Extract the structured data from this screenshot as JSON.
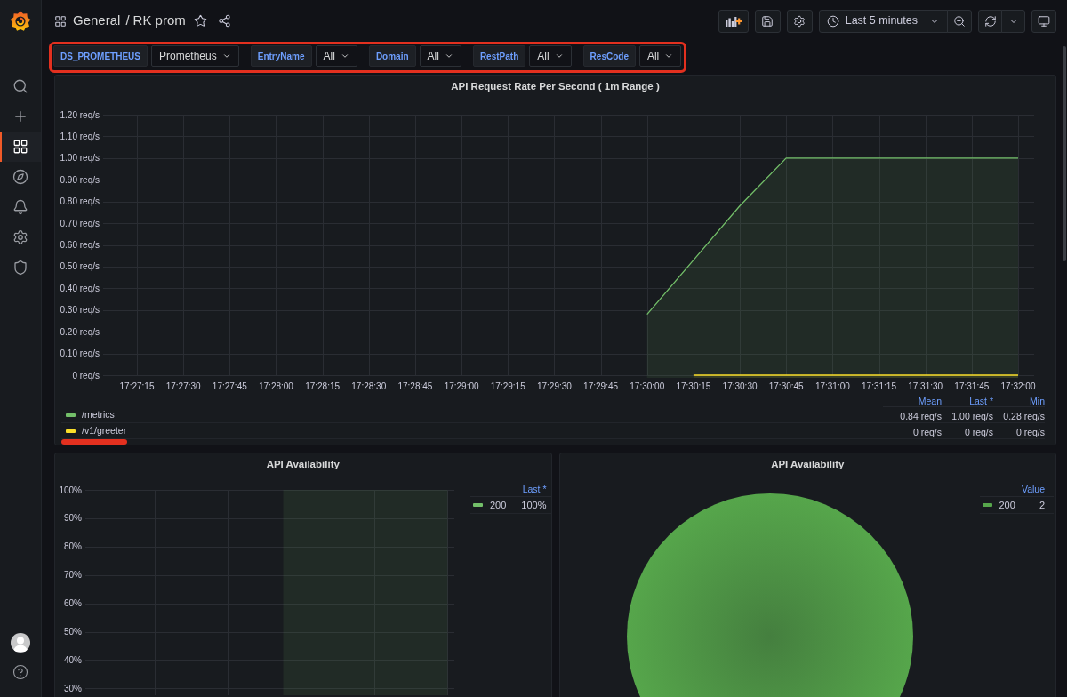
{
  "sidebar": {
    "items": [
      {
        "kind": "search",
        "selected": false
      },
      {
        "kind": "create",
        "selected": false
      },
      {
        "kind": "dashboards",
        "selected": true
      },
      {
        "kind": "explore",
        "selected": false
      },
      {
        "kind": "alerting",
        "selected": false
      },
      {
        "kind": "configuration",
        "selected": false
      },
      {
        "kind": "server_admin",
        "selected": false
      }
    ],
    "bottom": [
      {
        "kind": "profile"
      },
      {
        "kind": "help"
      }
    ]
  },
  "header": {
    "folder": "General",
    "separator": "/",
    "title": "RK prom",
    "starred": false
  },
  "toolbar": [
    {
      "kind": "add_panel"
    },
    {
      "kind": "save"
    },
    {
      "kind": "settings"
    },
    {
      "kind": "time_range",
      "label": "Last 5 minutes"
    },
    {
      "kind": "zoom_out"
    },
    {
      "kind": "refresh"
    },
    {
      "kind": "refresh_interval"
    },
    {
      "kind": "tv_mode"
    }
  ],
  "variables": {
    "highlighted": true,
    "items": [
      {
        "label": "DS_PROMETHEUS",
        "value": "Prometheus"
      },
      {
        "label": "EntryName",
        "value": "All"
      },
      {
        "label": "Domain",
        "value": "All"
      },
      {
        "label": "RestPath",
        "value": "All"
      },
      {
        "label": "ResCode",
        "value": "All"
      }
    ]
  },
  "panels": [
    {
      "kind": "timeseries",
      "title": "API Request Rate Per Second ( 1m Range )",
      "chart_data": {
        "type": "area",
        "grid": true,
        "categories": [
          "17:27:15",
          "17:27:30",
          "17:27:45",
          "17:28:00",
          "17:28:15",
          "17:28:30",
          "17:28:45",
          "17:29:00",
          "17:29:15",
          "17:29:30",
          "17:29:45",
          "17:30:00",
          "17:30:15",
          "17:30:30",
          "17:30:45",
          "17:31:00",
          "17:31:15",
          "17:31:30",
          "17:31:45",
          "17:32:00"
        ],
        "ylim": [
          0,
          1.2
        ],
        "yticks": [
          {
            "value": 1.2,
            "label": "1.20 req/s"
          },
          {
            "value": 1.1,
            "label": "1.10 req/s"
          },
          {
            "value": 1,
            "label": "1.00 req/s"
          },
          {
            "value": 0.9,
            "label": "0.90 req/s"
          },
          {
            "value": 0.8,
            "label": "0.80 req/s"
          },
          {
            "value": 0.7,
            "label": "0.70 req/s"
          },
          {
            "value": 0.6,
            "label": "0.60 req/s"
          },
          {
            "value": 0.5,
            "label": "0.50 req/s"
          },
          {
            "value": 0.4,
            "label": "0.40 req/s"
          },
          {
            "value": 0.3,
            "label": "0.30 req/s"
          },
          {
            "value": 0.2,
            "label": "0.20 req/s"
          },
          {
            "value": 0.1,
            "label": "0.10 req/s"
          },
          {
            "value": 0,
            "label": "0 req/s"
          }
        ],
        "series": [
          {
            "name": "/metrics",
            "color": "#73bf69",
            "values": [
              null,
              null,
              null,
              null,
              null,
              null,
              null,
              null,
              null,
              null,
              null,
              0.28,
              0.53,
              0.78,
              1,
              1,
              1,
              1,
              1,
              1
            ]
          },
          {
            "name": "/v1/greeter",
            "color": "#fade2a",
            "values": [
              null,
              null,
              null,
              null,
              null,
              null,
              null,
              null,
              null,
              null,
              null,
              null,
              0,
              0,
              0,
              0,
              0,
              0,
              0,
              0
            ]
          }
        ]
      },
      "legend": {
        "columns": [
          "Mean",
          "Last *",
          "Min"
        ],
        "rows": [
          {
            "values": [
              "0.84 req/s",
              "1.00 req/s",
              "0.28 req/s"
            ],
            "underlined": false
          },
          {
            "values": [
              "0 req/s",
              "0 req/s",
              "0 req/s"
            ],
            "underlined": true
          }
        ]
      }
    },
    {
      "kind": "graph",
      "title": "API Availability",
      "y_axis_labels": [
        "100%",
        "90%",
        "80%",
        "70%",
        "60%",
        "50%",
        "40%",
        "30%"
      ],
      "legend": {
        "columns": [
          "Last *"
        ],
        "rows": [
          {
            "name": "200",
            "color": "#73bf69",
            "values": [
              "100%"
            ]
          }
        ]
      }
    },
    {
      "kind": "piechart",
      "title": "API Availability",
      "chart_data": {
        "type": "pie",
        "categories": [
          "200"
        ],
        "series": [
          {
            "color": "#56a64b",
            "values": [
              100
            ]
          }
        ]
      },
      "legend": {
        "columns": [
          "Value"
        ],
        "rows": [
          {
            "values": [
              "2"
            ]
          }
        ]
      }
    }
  ]
}
